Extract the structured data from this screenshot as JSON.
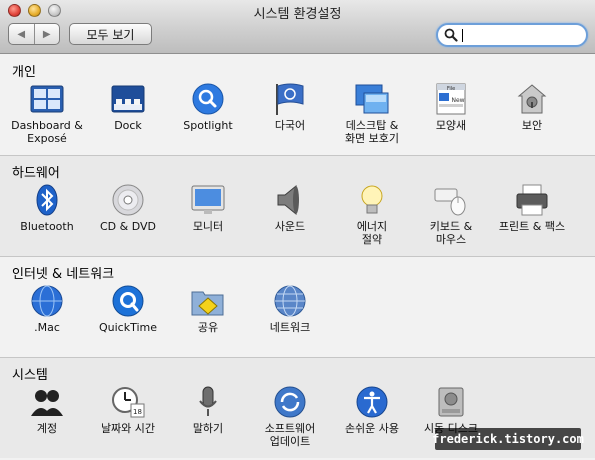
{
  "window": {
    "title": "시스템 환경설정"
  },
  "toolbar": {
    "back_label": "◀",
    "forward_label": "▶",
    "show_all_label": "모두 보기",
    "search_value": ""
  },
  "sections": [
    {
      "title": "개인",
      "items": [
        {
          "label": "Dashboard &\nExposé",
          "icon": "dashboard-expose-icon"
        },
        {
          "label": "Dock",
          "icon": "dock-icon"
        },
        {
          "label": "Spotlight",
          "icon": "spotlight-icon"
        },
        {
          "label": "다국어",
          "icon": "international-icon"
        },
        {
          "label": "데스크탑 &\n화면 보호기",
          "icon": "desktop-screensaver-icon"
        },
        {
          "label": "모양새",
          "icon": "appearance-icon"
        },
        {
          "label": "보안",
          "icon": "security-icon"
        }
      ]
    },
    {
      "title": "하드웨어",
      "items": [
        {
          "label": "Bluetooth",
          "icon": "bluetooth-icon"
        },
        {
          "label": "CD & DVD",
          "icon": "cd-dvd-icon"
        },
        {
          "label": "모니터",
          "icon": "displays-icon"
        },
        {
          "label": "사운드",
          "icon": "sound-icon"
        },
        {
          "label": "에너지\n절약",
          "icon": "energy-saver-icon"
        },
        {
          "label": "키보드 &\n마우스",
          "icon": "keyboard-mouse-icon"
        },
        {
          "label": "프린트 & 팩스",
          "icon": "print-fax-icon"
        }
      ]
    },
    {
      "title": "인터넷 & 네트워크",
      "items": [
        {
          "label": ".Mac",
          "icon": "dotmac-icon"
        },
        {
          "label": "QuickTime",
          "icon": "quicktime-icon"
        },
        {
          "label": "공유",
          "icon": "sharing-icon"
        },
        {
          "label": "네트워크",
          "icon": "network-icon"
        }
      ]
    },
    {
      "title": "시스템",
      "items": [
        {
          "label": "계정",
          "icon": "accounts-icon"
        },
        {
          "label": "날짜와 시간",
          "icon": "date-time-icon"
        },
        {
          "label": "말하기",
          "icon": "speech-icon"
        },
        {
          "label": "소프트웨어\n업데이트",
          "icon": "software-update-icon"
        },
        {
          "label": "손쉬운 사용",
          "icon": "universal-access-icon"
        },
        {
          "label": "시동 디스크",
          "icon": "startup-disk-icon"
        }
      ]
    }
  ],
  "watermark": "frederick.tistory.com"
}
